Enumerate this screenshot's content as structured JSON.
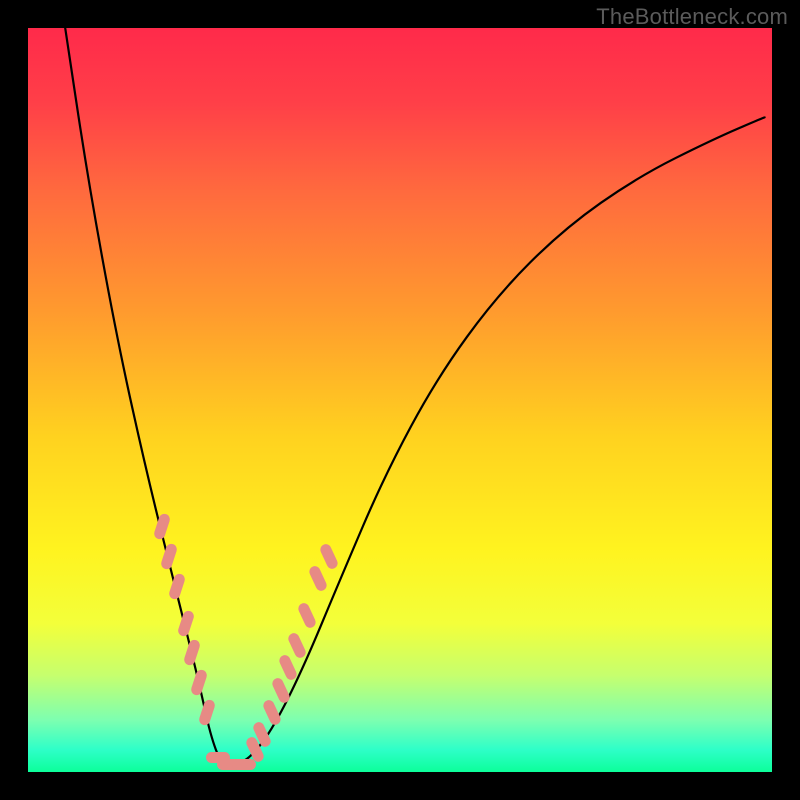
{
  "watermark": {
    "text": "TheBottleneck.com"
  },
  "colors": {
    "frame": "#000000",
    "gradient_stops": [
      {
        "stop": 0.0,
        "color": "#ff2a4a"
      },
      {
        "stop": 0.1,
        "color": "#ff3f48"
      },
      {
        "stop": 0.22,
        "color": "#ff6a3e"
      },
      {
        "stop": 0.38,
        "color": "#ff9a2e"
      },
      {
        "stop": 0.55,
        "color": "#ffd21f"
      },
      {
        "stop": 0.7,
        "color": "#fff31f"
      },
      {
        "stop": 0.8,
        "color": "#f3ff3a"
      },
      {
        "stop": 0.87,
        "color": "#c6ff6e"
      },
      {
        "stop": 0.93,
        "color": "#7dffb0"
      },
      {
        "stop": 0.97,
        "color": "#2effc8"
      },
      {
        "stop": 1.0,
        "color": "#0cff9a"
      }
    ],
    "curve_stroke": "#000000",
    "dash_fill": "#e78a85"
  },
  "chart_data": {
    "type": "line",
    "title": "",
    "xlabel": "",
    "ylabel": "",
    "xlim": [
      0,
      100
    ],
    "ylim": [
      0,
      100
    ],
    "series": [
      {
        "name": "bottleneck-curve",
        "x": [
          5,
          8,
          12,
          16,
          20,
          23,
          24.5,
          26,
          28,
          30,
          33,
          37,
          42,
          48,
          55,
          63,
          72,
          82,
          92,
          99
        ],
        "y": [
          100,
          80,
          58,
          40,
          24,
          12,
          5,
          1,
          1,
          2,
          6,
          14,
          26,
          40,
          53,
          64,
          73,
          80,
          85,
          88
        ]
      }
    ],
    "highlight_dashes": {
      "left_branch": [
        {
          "x": 18,
          "y": 33
        },
        {
          "x": 19,
          "y": 29
        },
        {
          "x": 20,
          "y": 25
        },
        {
          "x": 21.2,
          "y": 20
        },
        {
          "x": 22,
          "y": 16
        },
        {
          "x": 23,
          "y": 12
        },
        {
          "x": 24,
          "y": 8
        }
      ],
      "valley": [
        {
          "x": 25.5,
          "y": 2
        },
        {
          "x": 27,
          "y": 1
        },
        {
          "x": 29,
          "y": 1
        }
      ],
      "right_branch": [
        {
          "x": 30.5,
          "y": 3
        },
        {
          "x": 31.5,
          "y": 5
        },
        {
          "x": 32.8,
          "y": 8
        },
        {
          "x": 34,
          "y": 11
        },
        {
          "x": 35,
          "y": 14
        },
        {
          "x": 36.2,
          "y": 17
        },
        {
          "x": 37.5,
          "y": 21
        },
        {
          "x": 39,
          "y": 26
        },
        {
          "x": 40.5,
          "y": 29
        }
      ]
    }
  }
}
